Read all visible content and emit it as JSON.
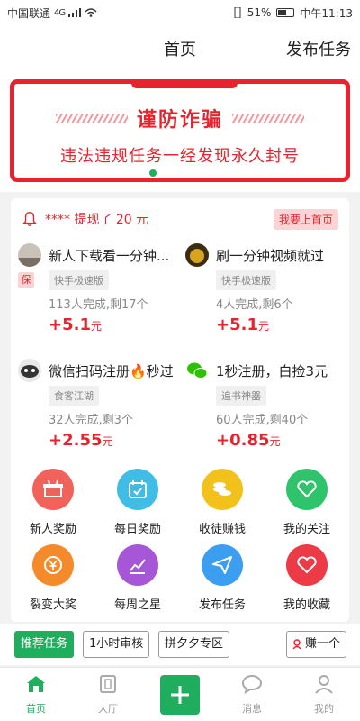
{
  "status_bar": {
    "carrier": "中国联通",
    "network": "4G",
    "battery": "51%",
    "time": "中午11:13"
  },
  "nav": {
    "title": "首页",
    "publish": "发布任务"
  },
  "banner": {
    "headline": "谨防诈骗",
    "warning": "违法违规任务一经发现永久封号"
  },
  "notice": {
    "text": "**** 提现了 20 元",
    "button": "我要上首页"
  },
  "tasks": [
    {
      "name": "新人下载看一分钟...",
      "badge": "保",
      "tag": "快手极速版",
      "stat": "113人完成,剩17个",
      "price": "+5.1",
      "unit": "元"
    },
    {
      "name": "刷一分钟视频就过",
      "tag": "快手极速版",
      "stat": "4人完成,剩6个",
      "price": "+5.1",
      "unit": "元"
    },
    {
      "name": "微信扫码注册🔥秒过",
      "tag": "食客江湖",
      "stat": "32人完成,剩3个",
      "price": "+2.55",
      "unit": "元"
    },
    {
      "name": "1秒注册，白捡3元",
      "tag": "追书神器",
      "stat": "60人完成,剩40个",
      "price": "+0.85",
      "unit": "元"
    }
  ],
  "grid": [
    {
      "label": "新人奖励",
      "icon": "gift-icon",
      "color": "#f0625a"
    },
    {
      "label": "每日奖励",
      "icon": "calendar-icon",
      "color": "#3fbde6"
    },
    {
      "label": "收徒赚钱",
      "icon": "coins-icon",
      "color": "#f2c11c"
    },
    {
      "label": "我的关注",
      "icon": "heart-outline-icon",
      "color": "#2fc46c"
    },
    {
      "label": "裂变大奖",
      "icon": "yen-coin-icon",
      "color": "#f58a2a"
    },
    {
      "label": "每周之星",
      "icon": "chart-icon",
      "color": "#a657d8"
    },
    {
      "label": "发布任务",
      "icon": "paper-plane-icon",
      "color": "#3b9ef0"
    },
    {
      "label": "我的收藏",
      "icon": "heart-icon",
      "color": "#ec3b47"
    }
  ],
  "chips": {
    "recommend": "推荐任务",
    "one_hour": "1小时审核",
    "pdd": "拼夕夕专区",
    "earn": "赚一个"
  },
  "tabbar": {
    "home": "首页",
    "hall": "大厅",
    "messages": "消息",
    "mine": "我的"
  },
  "colors": {
    "accent": "#1fae5e",
    "alert": "#e8232d"
  }
}
